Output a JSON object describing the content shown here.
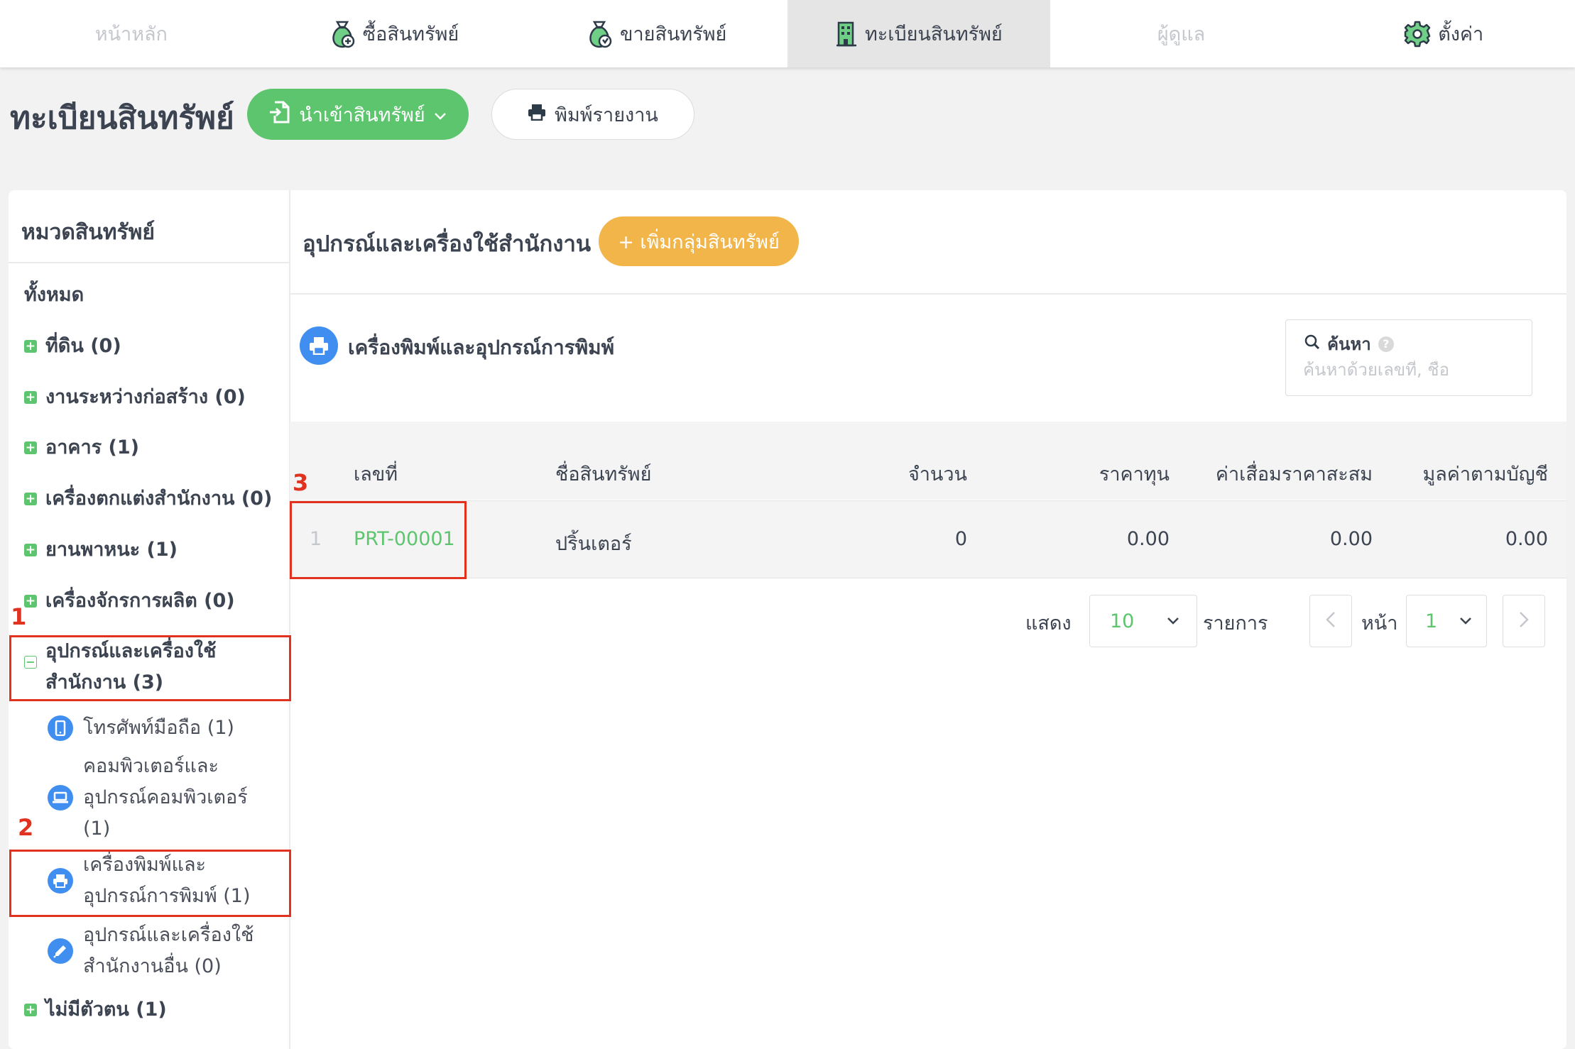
{
  "nav": {
    "items": [
      {
        "label": "หน้าหลัก"
      },
      {
        "label": "ซื้อสินทรัพย์"
      },
      {
        "label": "ขายสินทรัพย์"
      },
      {
        "label": "ทะเบียนสินทรัพย์"
      },
      {
        "label": "ผู้ดูแล"
      },
      {
        "label": "ตั้งค่า"
      }
    ]
  },
  "header": {
    "title": "ทะเบียนสินทรัพย์",
    "import_label": "นำเข้าสินทรัพย์",
    "print_label": "พิมพ์รายงาน"
  },
  "sidebar": {
    "title": "หมวดสินทรัพย์",
    "all_label": "ทั้งหมด",
    "categories": [
      {
        "label": "ที่ดิน (0)"
      },
      {
        "label": "งานระหว่างก่อสร้าง (0)"
      },
      {
        "label": "อาคาร (1)"
      },
      {
        "label": "เครื่องตกแต่งสำนักงาน (0)"
      },
      {
        "label": "ยานพาหนะ (1)"
      },
      {
        "label": "เครื่องจักรการผลิต (0)"
      },
      {
        "label_line1": "อุปกรณ์และเครื่องใช้",
        "label_line2": "สำนักงาน (3)"
      },
      {
        "label": "ไม่มีตัวตน (1)"
      }
    ],
    "subcategories": [
      {
        "line1": "โทรศัพท์มือถือ (1)",
        "icon": "mobile-phone-icon"
      },
      {
        "line1": "คอมพิวเตอร์และ",
        "line2": "อุปกรณ์คอมพิวเตอร์",
        "line3": "(1)",
        "icon": "laptop-icon"
      },
      {
        "line1": "เครื่องพิมพ์และ",
        "line2": "อุปกรณ์การพิมพ์ (1)",
        "icon": "printer-icon"
      },
      {
        "line1": "อุปกรณ์และเครื่องใช้",
        "line2": "สำนักงานอื่น (0)",
        "icon": "pen-icon"
      }
    ]
  },
  "annotations": [
    "1",
    "2",
    "3"
  ],
  "content": {
    "group_title": "อุปกรณ์และเครื่องใช้สำนักงาน",
    "add_group_label": "+ เพิ่มกลุ่มสินทรัพย์",
    "subgroup_title": "เครื่องพิมพ์และอุปกรณ์การพิมพ์",
    "search": {
      "label": "ค้นหา",
      "placeholder": "ค้นหาด้วยเลขที่, ชื่อ"
    }
  },
  "table": {
    "columns": [
      "เลขที่",
      "ชื่อสินทรัพย์",
      "จำนวน",
      "ราคาทุน",
      "ค่าเสื่อมราคาสะสม",
      "มูลค่าตามบัญชี"
    ],
    "rows": [
      {
        "index": "1",
        "code": "PRT-00001",
        "name": "ปริ้นเตอร์",
        "qty": "0",
        "cost": "0.00",
        "depreciation": "0.00",
        "book_value": "0.00"
      }
    ]
  },
  "pagination": {
    "show_label": "แสดง",
    "page_size": "10",
    "items_label": "รายการ",
    "page_label": "หน้า",
    "page": "1"
  },
  "colors": {
    "accent_green": "#5dc56e",
    "accent_orange": "#f2b54a",
    "accent_blue": "#3f8ef0",
    "annotation_red": "#e0321f"
  }
}
